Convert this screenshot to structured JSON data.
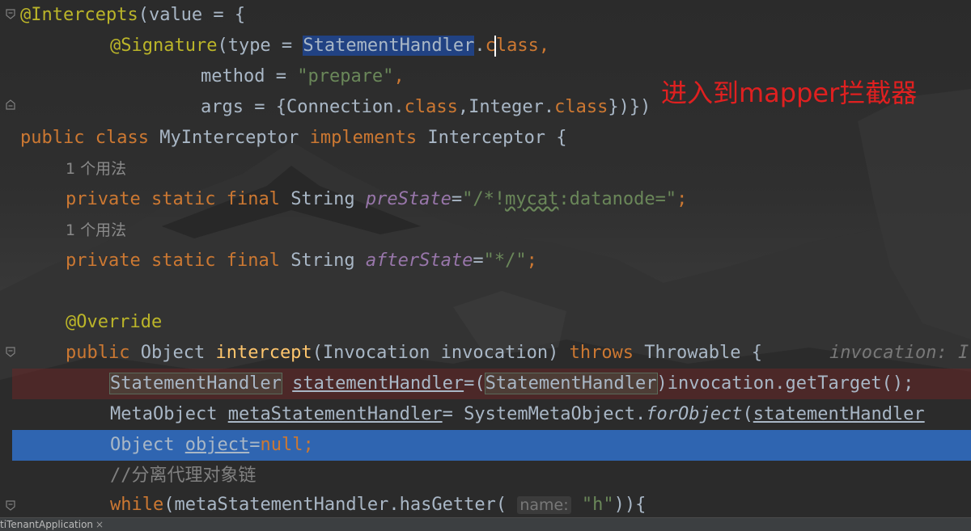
{
  "editor": {
    "lines": {
      "l1": {
        "annotation": "@Intercepts",
        "rest": "(value = {"
      },
      "l2": {
        "annotation": "@Signature",
        "open": "(type = ",
        "selected": "StatementHandler",
        "dot": ".",
        "kw": "class",
        "comma": ","
      },
      "l3": {
        "prefix": "method = ",
        "string": "\"prepare\"",
        "comma": ","
      },
      "l4": {
        "prefix": "args = {Connection.",
        "kw1": "class",
        "mid": ",Integer.",
        "kw2": "class",
        "suffix": "})})"
      },
      "l5": {
        "kw1": "public",
        "kw2": "class",
        "name": "MyInterceptor",
        "kw3": "implements",
        "iface": "Interceptor {"
      },
      "l6": {
        "hint": "1 个用法"
      },
      "l7": {
        "kw1": "private",
        "kw2": "static",
        "kw3": "final",
        "type": "String",
        "field": "preState",
        "eq": "=",
        "s1": "\"/*!",
        "s2": "mycat",
        "s3": ":datanode=\"",
        "semi": ";"
      },
      "l8": {
        "hint": "1 个用法"
      },
      "l9": {
        "kw1": "private",
        "kw2": "static",
        "kw3": "final",
        "type": "String",
        "field": "afterState",
        "eq": "=",
        "str": "\"*/\"",
        "semi": ";"
      },
      "l11": {
        "annotation": "@Override"
      },
      "l12": {
        "kw1": "public",
        "type": "Object",
        "method": "intercept",
        "params": "(Invocation invocation) ",
        "kw2": "throws",
        "rest": " Throwable {",
        "ghost": "invocation: I"
      },
      "l13": {
        "type": "StatementHandler",
        "var": "statementHandler",
        "eq": "=(",
        "cast": "StatementHandler",
        "rest": ")invocation.getTarget();"
      },
      "l14": {
        "type": "MetaObject",
        "var": "metaStatementHandler",
        "eq": "= SystemMetaObject.",
        "call": "forObject",
        "paren": "(",
        "arg": "statementHandler"
      },
      "l15": {
        "type": "Object",
        "var": "object",
        "eq": "=",
        "kw": "null",
        "semi": ";"
      },
      "l16": {
        "comment": "//分离代理对象链"
      },
      "l17": {
        "kw": "while",
        "call": "(metaStatementHandler.hasGetter(",
        "inlay": "name:",
        "str": "\"h\"",
        "rest": ")){"
      }
    }
  },
  "overlay_note": "进入到mapper拦截器",
  "statusbar": {
    "app_label": "tiTenantApplication",
    "close": "×"
  },
  "colors": {
    "keyword": "#cc7832",
    "annotation": "#bbb529",
    "string": "#6a8759",
    "field": "#9876aa",
    "method": "#ffc66d",
    "current_line": "#2f65b1",
    "note": "#e02020"
  }
}
